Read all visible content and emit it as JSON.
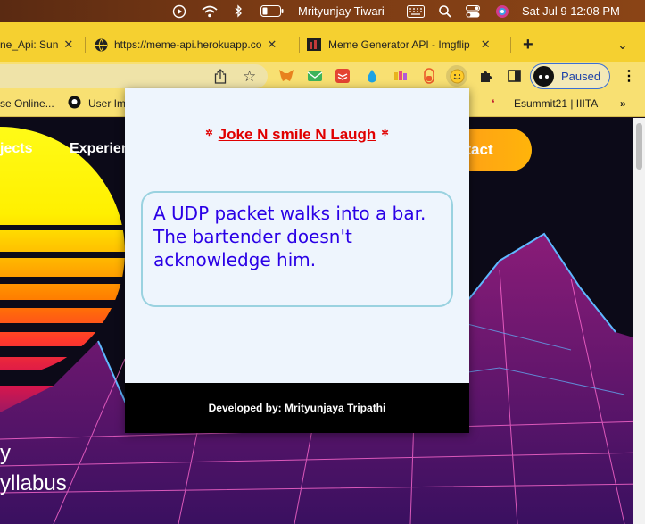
{
  "menubar": {
    "user_name": "Mrityunjay Tiwari",
    "datetime": "Sat Jul 9  12:08 PM",
    "icons": [
      "play-icon",
      "wifi-icon",
      "bluetooth-icon",
      "battery-icon",
      "keyboard-icon",
      "search-icon",
      "control-center-icon",
      "siri-icon"
    ]
  },
  "tabs": [
    {
      "label": "ne_Api: Sun",
      "active": false
    },
    {
      "label": "https://meme-api.herokuapp.co",
      "active": false
    },
    {
      "label": "Meme Generator API - Imgflip",
      "active": false
    }
  ],
  "toolbar": {
    "profile_label": "Paused",
    "extensions": [
      "metamask-icon",
      "mail-extension-icon",
      "todoist-icon",
      "drop-icon",
      "candles-icon",
      "capsule-icon",
      "smiley-extension-icon",
      "puzzle-icon",
      "sidepanel-icon"
    ]
  },
  "bookmarks": [
    {
      "label": "se Online..."
    },
    {
      "label": "User Im"
    },
    {
      "label": "Esummit21 | IIITA"
    }
  ],
  "page": {
    "nav": [
      "jects",
      "Experien",
      "ntact"
    ],
    "hero_lines": [
      "y",
      "yllabus"
    ]
  },
  "popup": {
    "title": "Joke N smile N Laugh",
    "joke": "A UDP packet walks into a bar. The bartender doesn't acknowledge him.",
    "footer": "Developed by: Mrityunjaya Tripathi"
  },
  "colors": {
    "tabstrip": "#f5d030",
    "toolbar": "#f8e072",
    "popup_bg": "#eef5fd",
    "title_red": "#e00000",
    "joke_blue": "#2a00e6",
    "joke_border": "#9ad2e0",
    "footer_bg": "#000000",
    "contact_orange": "#ff9a1a"
  }
}
